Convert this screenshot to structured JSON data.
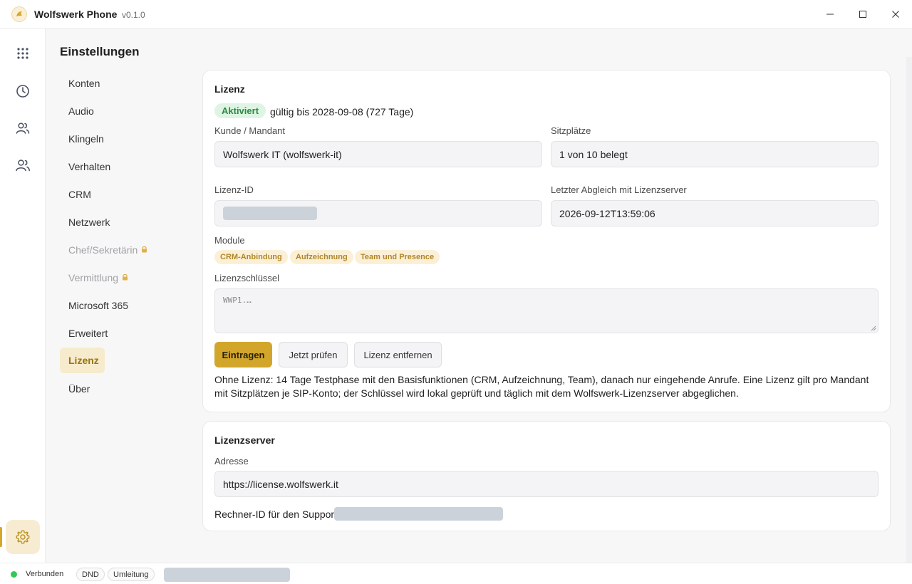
{
  "window": {
    "title": "Wolfswerk Phone",
    "version": "v0.1.0",
    "minimize_icon": "minimize-icon",
    "maximize_icon": "maximize-icon",
    "close_icon": "close-icon"
  },
  "rail": {
    "items": [
      {
        "icon": "dialpad-icon"
      },
      {
        "icon": "history-icon"
      },
      {
        "icon": "contacts-icon"
      },
      {
        "icon": "team-icon"
      }
    ],
    "settings_icon": "gear-icon",
    "accent": "#d4a72c"
  },
  "settings": {
    "title": "Einstellungen",
    "nav": [
      {
        "label": "Konten"
      },
      {
        "label": "Audio"
      },
      {
        "label": "Klingeln"
      },
      {
        "label": "Verhalten"
      },
      {
        "label": "CRM"
      },
      {
        "label": "Netzwerk"
      },
      {
        "label": "Chef/Sekretärin",
        "locked": true
      },
      {
        "label": "Vermittlung",
        "locked": true
      },
      {
        "label": "Microsoft 365"
      },
      {
        "label": "Erweitert"
      },
      {
        "label": "Lizenz",
        "active": true
      },
      {
        "label": "Über"
      }
    ]
  },
  "license": {
    "title": "Lizenz",
    "status_badge": "Aktiviert",
    "valid_text": "gültig bis 2028-09-08 (727 Tage)",
    "customer_label": "Kunde / Mandant",
    "customer_value": "Wolfswerk IT (wolfswerk-it)",
    "seats_label": "Sitzplätze",
    "seats_value": "1 von 10 belegt",
    "license_id_label": "Lizenz-ID",
    "last_sync_label": "Letzter Abgleich mit Lizenzserver",
    "last_sync_value": "2026-09-12T13:59:06",
    "modules_label": "Module",
    "modules": [
      "CRM-Anbindung",
      "Aufzeichnung",
      "Team und Presence"
    ],
    "key_label": "Lizenzschlüssel",
    "key_placeholder": "WWP1.…",
    "buttons": {
      "enter": "Eintragen",
      "check": "Jetzt prüfen",
      "remove": "Lizenz entfernen"
    },
    "info_text": "Ohne Lizenz: 14 Tage Testphase mit den Basisfunktionen (CRM, Aufzeichnung, Team), danach nur eingehende Anrufe. Eine Lizenz gilt pro Mandant mit Sitzplätzen je SIP-Konto; der Schlüssel wird lokal geprüft und täglich mit dem Wolfswerk-Lizenzserver abgeglichen.",
    "colors": {
      "active_badge_bg": "#dff5e3",
      "active_badge_fg": "#2c8a43",
      "primary_button": "#d2a62b",
      "module_chip_bg": "#fbf0d6"
    }
  },
  "server": {
    "title": "Lizenzserver",
    "address_label": "Adresse",
    "address_value": "https://license.wolfswerk.it",
    "support_label": "Rechner-ID für den Suppor"
  },
  "status": {
    "connection": "Verbunden",
    "connection_color": "#35c759",
    "dnd": "DND",
    "forward": "Umleitung"
  }
}
